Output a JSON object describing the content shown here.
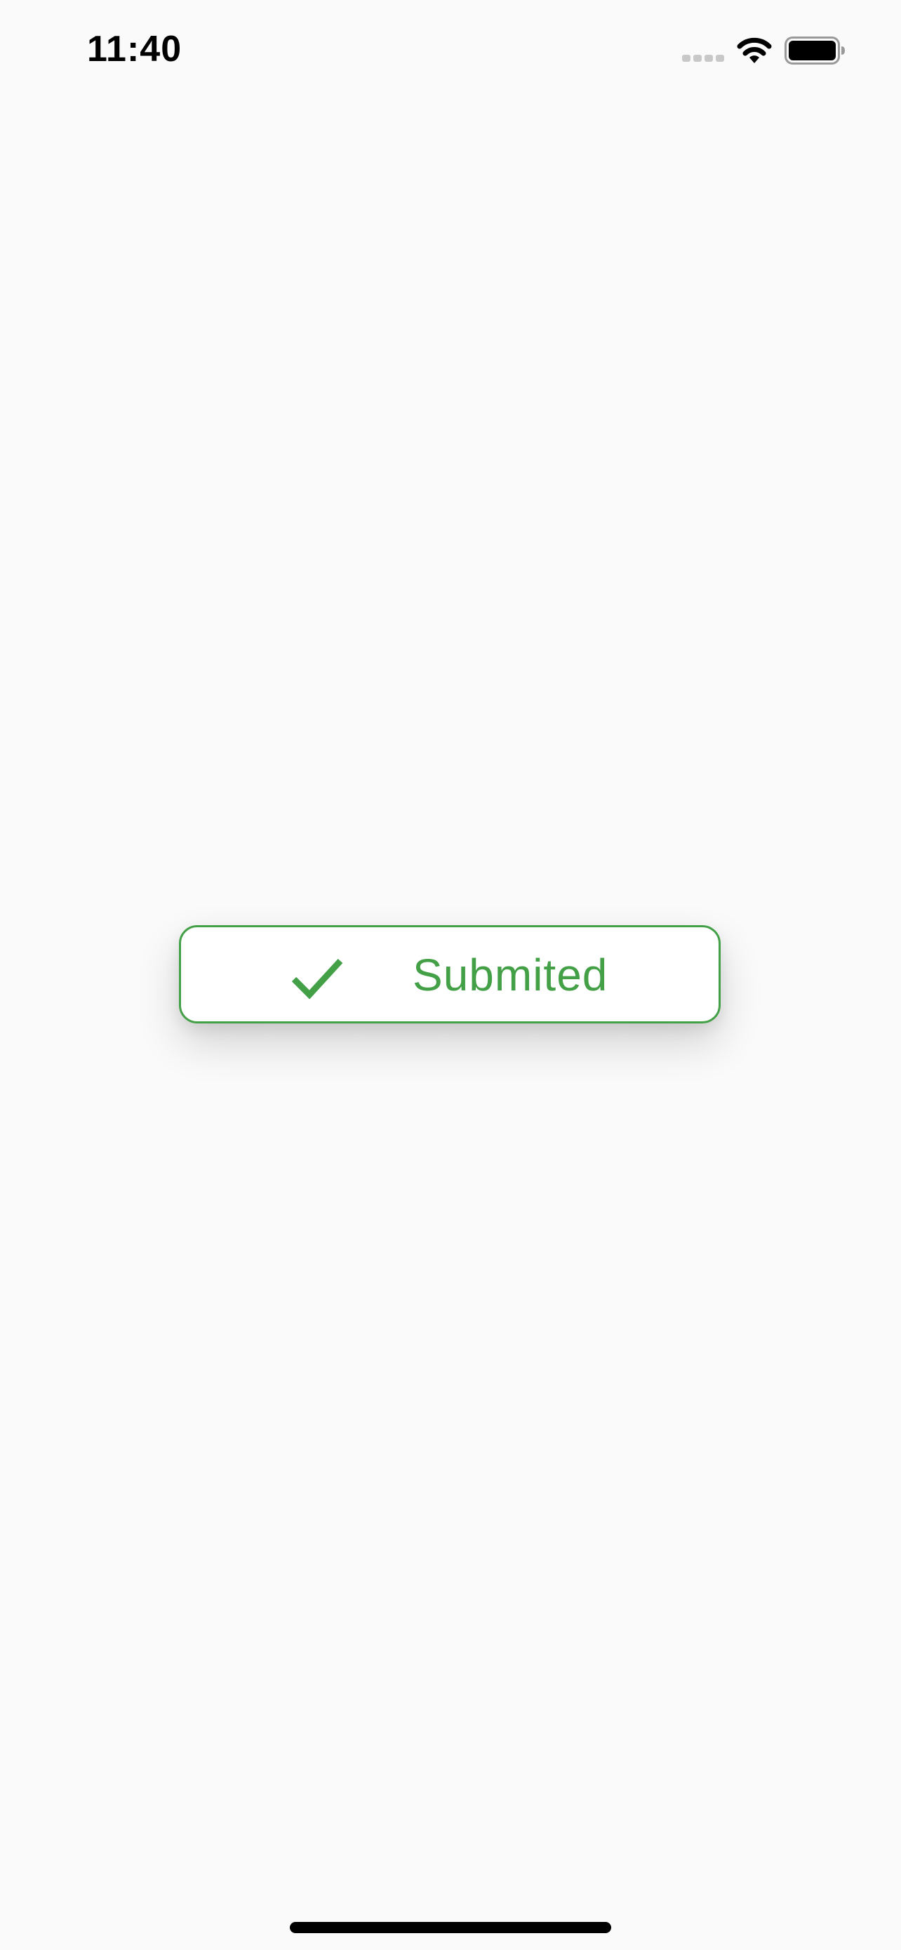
{
  "status_bar": {
    "time": "11:40",
    "signal_icon": "cellular-signal-icon",
    "wifi_icon": "wifi-icon",
    "battery_icon": "battery-icon"
  },
  "toast": {
    "icon": "checkmark-icon",
    "message": "Submited",
    "accent_color": "#43a047"
  },
  "colors": {
    "background": "#fafafa",
    "toast_background": "#ffffff",
    "accent": "#43a047"
  }
}
